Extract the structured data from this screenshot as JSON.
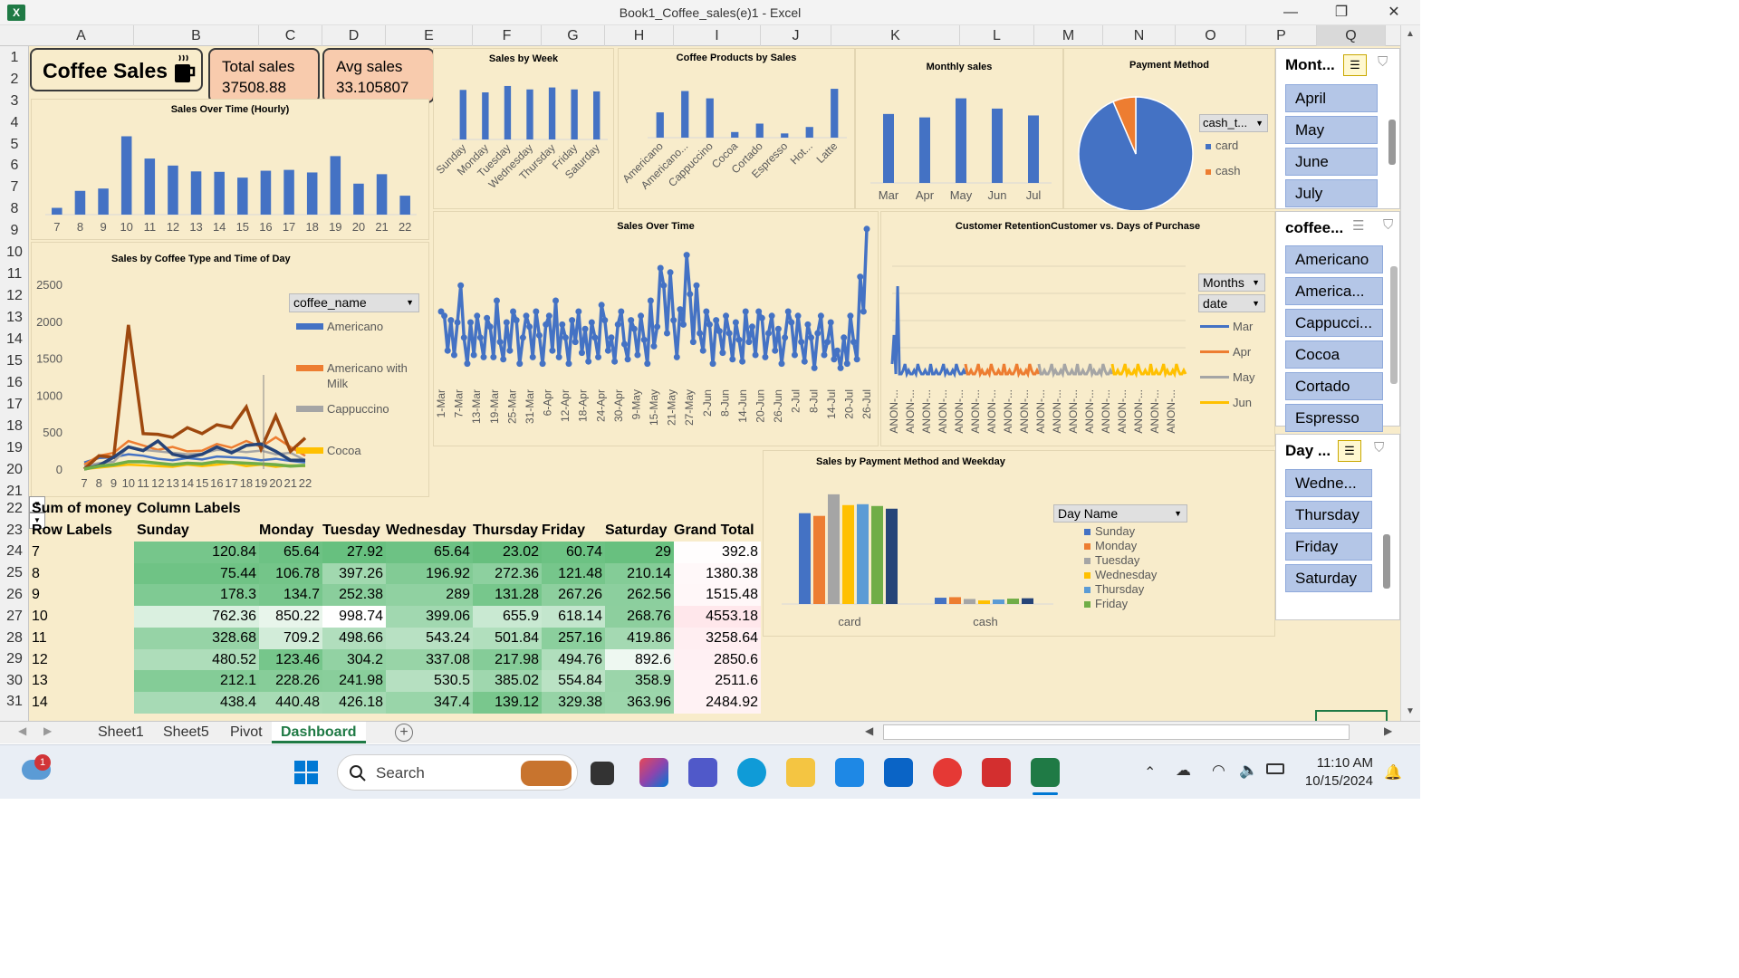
{
  "window": {
    "title": "Book1_Coffee_sales(e)1 - Excel",
    "min": "—",
    "restore": "❐",
    "close": "✕"
  },
  "columns": [
    "A",
    "B",
    "C",
    "D",
    "E",
    "F",
    "G",
    "H",
    "I",
    "J",
    "K",
    "L",
    "M",
    "N",
    "O",
    "P",
    "Q"
  ],
  "rows": [
    "1",
    "2",
    "3",
    "4",
    "5",
    "6",
    "7",
    "8",
    "9",
    "10",
    "11",
    "12",
    "13",
    "14",
    "15",
    "16",
    "17",
    "18",
    "19",
    "20",
    "21",
    "22",
    "23",
    "24",
    "25",
    "26",
    "27",
    "28",
    "29",
    "30",
    "31"
  ],
  "kpis": {
    "title": "Coffee Sales",
    "total_label": "Total sales",
    "total_value": "37508.88",
    "avg_label": "Avg sales",
    "avg_value": "33.105807",
    "colors": {
      "kpi_fill": "#f8cbad",
      "title_fill": "#f8eccb"
    }
  },
  "charts": {
    "hourly_title": "Sales Over Time (Hourly)",
    "week_title": "Sales by Week",
    "products_title": "Coffee Products by Sales",
    "monthly_title": "Monthly sales",
    "payment_title": "Payment Method",
    "coffee_time_title": "Sales by Coffee Type and Time of Day",
    "over_time_title": "Sales Over Time",
    "retention_title": "Customer RetentionCustomer vs. Days of Purchase",
    "payweek_title": "Sales by Payment Method and Weekday"
  },
  "chart_data": [
    {
      "type": "bar",
      "title": "Sales Over Time (Hourly)",
      "categories": [
        "7",
        "8",
        "9",
        "10",
        "11",
        "12",
        "13",
        "14",
        "15",
        "16",
        "17",
        "18",
        "19",
        "20",
        "21",
        "22"
      ],
      "values": [
        392.8,
        1380.38,
        1515.48,
        4553.18,
        3258.64,
        2850.6,
        2511.6,
        2484.92,
        2150,
        2550,
        2600,
        2450,
        3400,
        1800,
        2350,
        1100
      ],
      "ylim": [
        0,
        5000
      ]
    },
    {
      "type": "bar",
      "title": "Sales by Week",
      "categories": [
        "Sunday",
        "Monday",
        "Tuesday",
        "Wednesday",
        "Thursday",
        "Friday",
        "Saturday"
      ],
      "values": [
        5050,
        4800,
        5450,
        5100,
        5300,
        5100,
        4900
      ],
      "ylim": [
        0,
        6000
      ]
    },
    {
      "type": "bar",
      "title": "Coffee Products by Sales",
      "categories": [
        "Americano",
        "Americano...",
        "Cappuccino",
        "Cocoa",
        "Cortado",
        "Espresso",
        "Hot...",
        "Latte"
      ],
      "values": [
        4500,
        8300,
        7000,
        1000,
        2500,
        750,
        1900,
        8700
      ],
      "ylim": [
        0,
        10000
      ]
    },
    {
      "type": "bar",
      "title": "Monthly sales",
      "categories": [
        "Mar",
        "Apr",
        "May",
        "Jun",
        "Jul"
      ],
      "values": [
        7050,
        6700,
        8650,
        7600,
        6900
      ],
      "ylim": [
        0,
        10000
      ]
    },
    {
      "type": "pie",
      "title": "Payment Method",
      "labels": [
        "card",
        "cash"
      ],
      "values": [
        93.5,
        6.5
      ],
      "colors": [
        "#4472c4",
        "#ed7d31"
      ],
      "filter_label": "cash_t..."
    },
    {
      "type": "line",
      "title": "Sales by Coffee Type and Time of Day",
      "categories": [
        "7",
        "8",
        "9",
        "10",
        "11",
        "12",
        "13",
        "14",
        "15",
        "16",
        "17",
        "18",
        "19",
        "20",
        "21",
        "22"
      ],
      "ylim": [
        0,
        2500
      ],
      "yticks": [
        "0",
        "500",
        "1000",
        "1500",
        "2000",
        "2500"
      ],
      "filter_label": "coffee_name",
      "legend": [
        "Americano",
        "Americano with Milk",
        "Cappuccino",
        "Cocoa"
      ],
      "series": [
        {
          "name": "Americano",
          "color": "#4472c4",
          "values": [
            90,
            150,
            160,
            200,
            180,
            140,
            120,
            150,
            130,
            170,
            160,
            150,
            120,
            140,
            110,
            90
          ]
        },
        {
          "name": "Americano with Milk",
          "color": "#ed7d31",
          "values": [
            60,
            180,
            220,
            380,
            320,
            260,
            300,
            240,
            250,
            340,
            290,
            380,
            300,
            430,
            300,
            180
          ]
        },
        {
          "name": "Cappuccino",
          "color": "#a5a5a5",
          "values": [
            40,
            80,
            100,
            300,
            260,
            240,
            220,
            200,
            210,
            260,
            250,
            230,
            250,
            200,
            220,
            120
          ]
        },
        {
          "name": "Cocoa",
          "color": "#ffc000",
          "values": [
            0,
            20,
            40,
            60,
            50,
            40,
            30,
            60,
            40,
            60,
            80,
            40,
            60,
            30,
            50,
            40
          ]
        },
        {
          "name": "",
          "color": "#9e480e",
          "values": [
            0,
            180,
            160,
            1950,
            480,
            470,
            430,
            560,
            480,
            600,
            560,
            840,
            270,
            720,
            240,
            420
          ]
        },
        {
          "name": "",
          "color": "#264478",
          "values": [
            0,
            50,
            160,
            300,
            250,
            380,
            200,
            160,
            200,
            300,
            220,
            320,
            340,
            240,
            120,
            120
          ]
        },
        {
          "name": "",
          "color": "#70ad47",
          "values": [
            0,
            40,
            60,
            100,
            100,
            80,
            60,
            80,
            70,
            100,
            90,
            80,
            70,
            60,
            40,
            50
          ]
        }
      ]
    },
    {
      "type": "line",
      "title": "Sales Over Time",
      "x_labels": [
        "1-Mar",
        "7-Mar",
        "13-Mar",
        "19-Mar",
        "25-Mar",
        "31-Mar",
        "6-Apr",
        "12-Apr",
        "18-Apr",
        "24-Apr",
        "30-Apr",
        "9-May",
        "15-May",
        "21-May",
        "27-May",
        "2-Jun",
        "8-Jun",
        "14-Jun",
        "20-Jun",
        "26-Jun",
        "2-Jul",
        "8-Jul",
        "14-Jul",
        "20-Jul",
        "26-Jul"
      ],
      "values": [
        300,
        280,
        120,
        260,
        100,
        250,
        420,
        180,
        60,
        250,
        100,
        280,
        180,
        90,
        270,
        230,
        90,
        350,
        160,
        80,
        250,
        120,
        300,
        260,
        60,
        180,
        280,
        230,
        90,
        300,
        190,
        60,
        240,
        280,
        120,
        350,
        90,
        240,
        180,
        60,
        260,
        160,
        300,
        110,
        220,
        70,
        250,
        180,
        90,
        330,
        260,
        120,
        180,
        70,
        240,
        300,
        150,
        80,
        260,
        220,
        100,
        280,
        170,
        60,
        350,
        140,
        230,
        500,
        420,
        200,
        480,
        260,
        90,
        310,
        240,
        560,
        380,
        160,
        420,
        200,
        120,
        300,
        240,
        60,
        260,
        210,
        110,
        280,
        200,
        80,
        250,
        170,
        70,
        300,
        160,
        230,
        100,
        300,
        270,
        90,
        200,
        280,
        120,
        220,
        60,
        180,
        300,
        250,
        100,
        280,
        160,
        70,
        240,
        180,
        40,
        200,
        280,
        100,
        160,
        250,
        80,
        120,
        40,
        180,
        60,
        280,
        160,
        80,
        460,
        300,
        680
      ],
      "ylim": [
        0,
        700
      ]
    },
    {
      "type": "line",
      "title": "Customer RetentionCustomer vs. Days of Purchase",
      "x_label": "ANON-...",
      "x_count": 18,
      "filter_labels": [
        "Months",
        "date"
      ],
      "legend": [
        "Mar",
        "Apr",
        "May",
        "Jun"
      ],
      "series": [
        {
          "name": "Mar",
          "color": "#4472c4"
        },
        {
          "name": "Apr",
          "color": "#ed7d31"
        },
        {
          "name": "May",
          "color": "#a5a5a5"
        },
        {
          "name": "Jun",
          "color": "#ffc000"
        }
      ]
    },
    {
      "type": "bar",
      "title": "Sales by Payment Method and Weekday",
      "categories": [
        "card",
        "cash"
      ],
      "filter_label": "Day Name",
      "legend": [
        "Sunday",
        "Monday",
        "Tuesday",
        "Wednesday",
        "Thursday",
        "Friday"
      ],
      "series": [
        {
          "name": "Sunday",
          "color": "#4472c4",
          "values": [
            5050,
            350
          ]
        },
        {
          "name": "Monday",
          "color": "#ed7d31",
          "values": [
            4900,
            380
          ]
        },
        {
          "name": "Tuesday",
          "color": "#a5a5a5",
          "values": [
            6100,
            280
          ]
        },
        {
          "name": "Wednesday",
          "color": "#ffc000",
          "values": [
            5500,
            200
          ]
        },
        {
          "name": "Thursday",
          "color": "#5b9bd5",
          "values": [
            5550,
            250
          ]
        },
        {
          "name": "Friday",
          "color": "#70ad47",
          "values": [
            5450,
            300
          ]
        },
        {
          "name": "",
          "color": "#264478",
          "values": [
            5300,
            320
          ]
        }
      ],
      "ylim": [
        0,
        7000
      ]
    }
  ],
  "pivot": {
    "sum_label": "Sum of money",
    "col_labels": "Column Labels",
    "row_labels": "Row Labels",
    "headers": [
      "Sunday",
      "Monday",
      "Tuesday",
      "Wednesday",
      "Thursday",
      "Friday",
      "Saturday",
      "Grand Total"
    ],
    "rows": [
      {
        "label": "7",
        "values": [
          "120.84",
          "65.64",
          "27.92",
          "65.64",
          "23.02",
          "60.74",
          "29",
          "392.8"
        ]
      },
      {
        "label": "8",
        "values": [
          "75.44",
          "106.78",
          "397.26",
          "196.92",
          "272.36",
          "121.48",
          "210.14",
          "1380.38"
        ]
      },
      {
        "label": "9",
        "values": [
          "178.3",
          "134.7",
          "252.38",
          "289",
          "131.28",
          "267.26",
          "262.56",
          "1515.48"
        ]
      },
      {
        "label": "10",
        "values": [
          "762.36",
          "850.22",
          "998.74",
          "399.06",
          "655.9",
          "618.14",
          "268.76",
          "4553.18"
        ]
      },
      {
        "label": "11",
        "values": [
          "328.68",
          "709.2",
          "498.66",
          "543.24",
          "501.84",
          "257.16",
          "419.86",
          "3258.64"
        ]
      },
      {
        "label": "12",
        "values": [
          "480.52",
          "123.46",
          "304.2",
          "337.08",
          "217.98",
          "494.76",
          "892.6",
          "2850.6"
        ]
      },
      {
        "label": "13",
        "values": [
          "212.1",
          "228.26",
          "241.98",
          "530.5",
          "385.02",
          "554.84",
          "358.9",
          "2511.6"
        ]
      },
      {
        "label": "14",
        "values": [
          "438.4",
          "440.48",
          "426.18",
          "347.4",
          "139.12",
          "329.38",
          "363.96",
          "2484.92"
        ]
      }
    ]
  },
  "slicers": {
    "months": {
      "title": "Mont...",
      "items": [
        "April",
        "May",
        "June",
        "July"
      ]
    },
    "coffee": {
      "title": "coffee...",
      "items": [
        "Americano",
        "America...",
        "Cappucci...",
        "Cocoa",
        "Cortado",
        "Espresso"
      ]
    },
    "day": {
      "title": "Day ...",
      "items": [
        "Wedne...",
        "Thursday",
        "Friday",
        "Saturday"
      ]
    }
  },
  "tabs": [
    "Sheet1",
    "Sheet5",
    "Pivot",
    "Dashboard"
  ],
  "taskbar": {
    "search_placeholder": "Search",
    "time": "11:10 AM",
    "date": "10/15/2024",
    "badge": "1"
  }
}
